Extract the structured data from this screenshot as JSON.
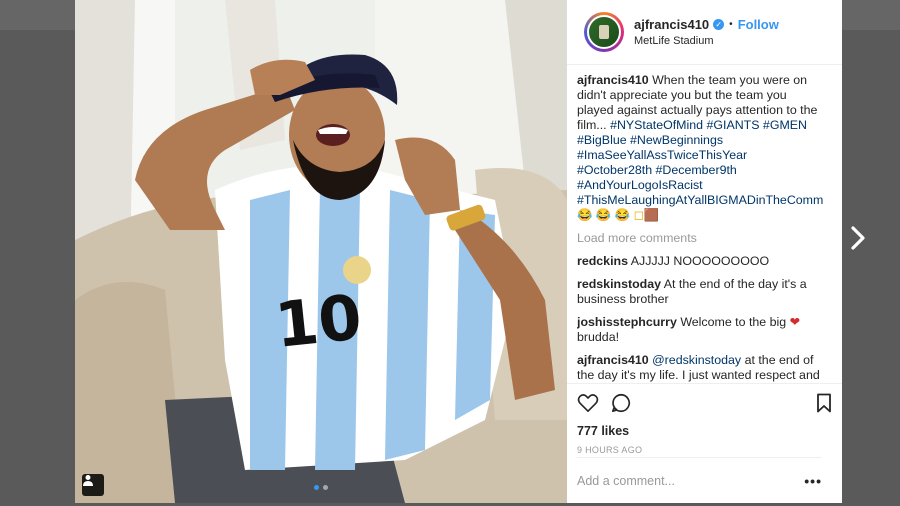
{
  "post": {
    "username": "ajfrancis410",
    "follow_label": "Follow",
    "separator": "•",
    "location": "MetLife Stadium",
    "caption": {
      "user": "ajfrancis410",
      "text": "When the team you were on didn't appreciate you but the team you played against actually pays attention to the film...",
      "tags": "#NYStateOfMind #GIANTS #GMEN #BigBlue #NewBeginnings #ImaSeeYallAssTwiceThisYear #October28th #December9th #AndYourLogoIsRacist #ThisMeLaughingAtYallBIGMADinTheCommentsToo",
      "emoji": "😂 😂 😂 ◻🟫"
    },
    "load_more": "Load more comments",
    "comments": [
      {
        "user": "redckins",
        "text": "AJJJJJ NOOOOOOOOO"
      },
      {
        "user": "redskinstoday",
        "text": "At the end of the day it's a business brother"
      },
      {
        "user": "joshisstephcurry",
        "text": "Welcome to the big",
        "emoji": "❤",
        "text_after": "brudda!"
      },
      {
        "user": "ajfrancis410",
        "text_tag": "@redskinstoday",
        "text": "at the end of the day it's my life. I just wanted respect and I never got it, it's cool tho, if I was Kanye I'd screenshot all the DMs and texts from"
      }
    ],
    "likes": "777 likes",
    "time": "9 HOURS AGO",
    "add_comment_placeholder": "Add a comment...",
    "more_options": "•••"
  },
  "icons": {
    "like": "heart-outline-icon",
    "comment": "speech-bubble-icon",
    "save": "bookmark-icon",
    "user_tags": "person-icon",
    "next": "chevron-right-icon",
    "verified": "verified-badge-icon"
  },
  "colors": {
    "link_blue": "#3897f0",
    "hashtag": "#003569",
    "muted": "#999999",
    "backdrop": "#5a5a5a"
  }
}
